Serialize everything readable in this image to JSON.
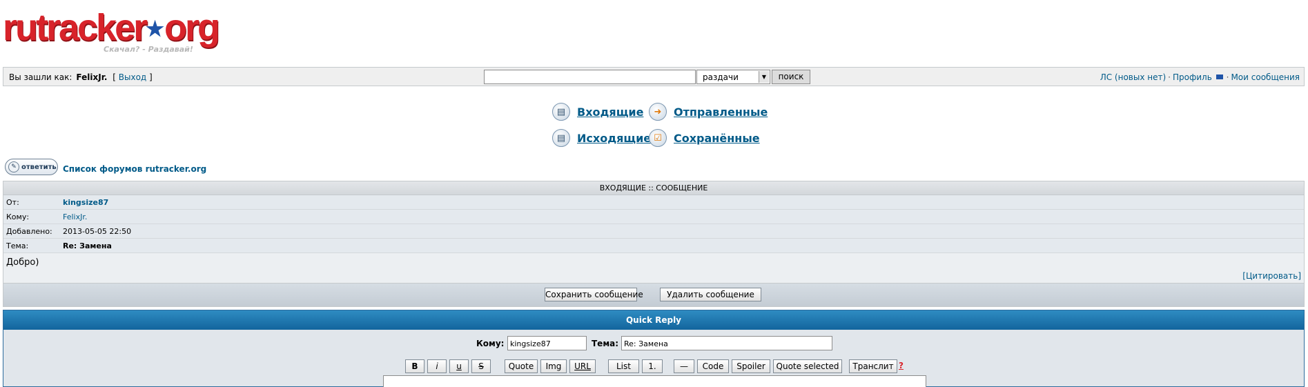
{
  "logo": {
    "text_a": "rutracker",
    "text_b": "org",
    "slogan": "Скачал? - Раздавай!"
  },
  "topbar": {
    "logged_in_as": "Вы зашли как:",
    "username": "FelixJr.",
    "logout": "Выход",
    "search_value": "",
    "search_select": "раздачи",
    "search_button": "поиск",
    "pm_link": "ЛС (новых нет)",
    "profile_link": "Профиль",
    "my_posts_link": "Мои сообщения"
  },
  "folders": {
    "inbox": "Входящие",
    "sent": "Отправленные",
    "outbox": "Исходящие",
    "saved": "Сохранённые"
  },
  "reply_button": "ответить",
  "forum_list": "Список форумов rutracker.org",
  "message": {
    "header": "ВХОДЯЩИЕ :: СООБЩЕНИЕ",
    "from_label": "От:",
    "from_value": "kingsize87",
    "to_label": "Кому:",
    "to_value": "FelixJr.",
    "added_label": "Добавлено:",
    "added_value": "2013-05-05 22:50",
    "subject_label": "Тема:",
    "subject_value": "Re: Замена",
    "body": "Добро)",
    "quote": "[Цитировать]",
    "save_button": "Сохранить сообщение",
    "delete_button": "Удалить сообщение"
  },
  "quick_reply": {
    "title": "Quick Reply",
    "to_label": "Кому:",
    "to_value": "kingsize87",
    "subject_label": "Тема:",
    "subject_value": "Re: Замена",
    "toolbar": {
      "bold": "B",
      "italic": "i",
      "underline": "u",
      "strike": "S",
      "quote": "Quote",
      "img": "Img",
      "url": "URL",
      "list": "List",
      "numbered": "1.",
      "hr": "—",
      "code": "Code",
      "spoiler": "Spoiler",
      "quote_selected": "Quote selected",
      "translit": "Транслит",
      "help": "?"
    }
  }
}
